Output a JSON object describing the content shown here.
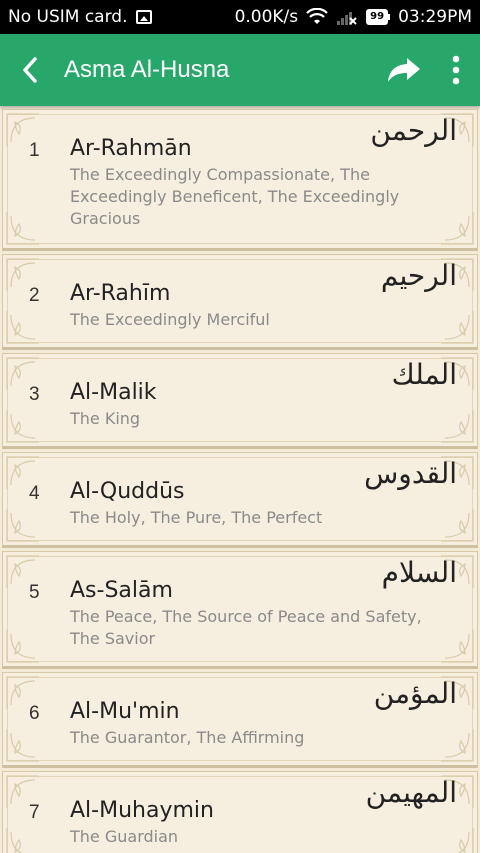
{
  "status": {
    "carrier": "No USIM card.",
    "speed": "0.00K/s",
    "battery": "99",
    "time": "03:29PM"
  },
  "appbar": {
    "title": "Asma Al-Husna",
    "back_icon": "back-arrow-icon",
    "share_icon": "share-icon",
    "menu_icon": "overflow-menu-icon"
  },
  "colors": {
    "appbar": "#27a86a",
    "card_bg": "#f6efe0",
    "meaning_text": "#8a8a8a"
  },
  "names": [
    {
      "num": "1",
      "name": "Ar-Rahmān",
      "meaning": "The Exceedingly Compassionate, The Exceedingly Beneficent, The Exceedingly Gracious",
      "arabic": "الرحمن"
    },
    {
      "num": "2",
      "name": "Ar-Rahīm",
      "meaning": "The Exceedingly Merciful",
      "arabic": "الرحيم"
    },
    {
      "num": "3",
      "name": "Al-Malik",
      "meaning": "The King",
      "arabic": "الملك"
    },
    {
      "num": "4",
      "name": "Al-Quddūs",
      "meaning": "The Holy, The Pure, The Perfect",
      "arabic": "القدوس"
    },
    {
      "num": "5",
      "name": "As-Salām",
      "meaning": "The Peace, The Source of Peace and Safety, The Savior",
      "arabic": "السلام"
    },
    {
      "num": "6",
      "name": "Al-Mu'min",
      "meaning": "The Guarantor, The Affirming",
      "arabic": "المؤمن"
    },
    {
      "num": "7",
      "name": "Al-Muhaymin",
      "meaning": "The Guardian",
      "arabic": "المهيمن"
    }
  ]
}
